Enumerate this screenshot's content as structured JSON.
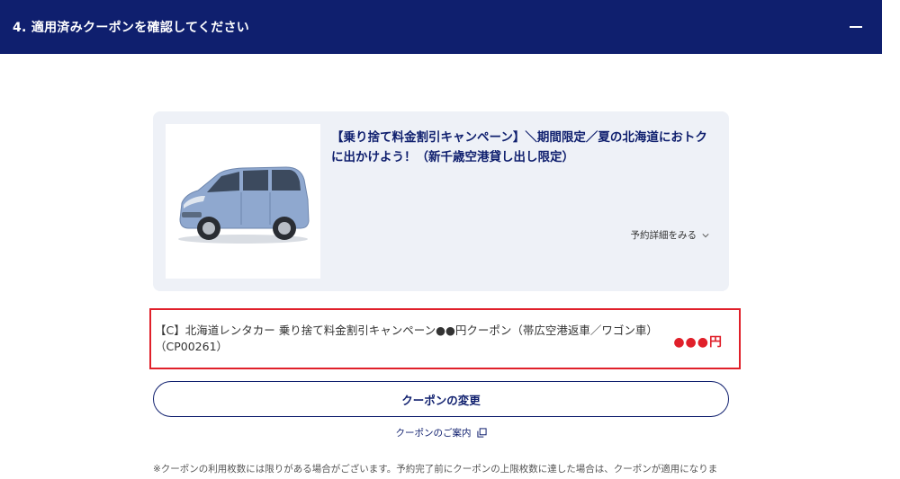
{
  "header": {
    "title": "4. 適用済みクーポンを確認してください"
  },
  "card": {
    "title": "【乗り捨て料金割引キャンペーン】＼期間限定／夏の北海道におトクに出かけよう！（新千歳空港貸し出し限定）",
    "details_label": "予約詳細をみる"
  },
  "coupon": {
    "name": "【C】北海道レンタカー 乗り捨て料金割引キャンペーン●●円クーポン（帯広空港返車／ワゴン車）（CP00261）",
    "amount": "●●●円"
  },
  "actions": {
    "change_label": "クーポンの変更",
    "guide_label": "クーポンのご案内"
  },
  "note": "※クーポンの利用枚数には限りがある場合がございます。予約完了前にクーポンの上限枚数に達した場合は、クーポンが適用になりま",
  "colors": {
    "header_bg": "#0f1f6e",
    "accent_red": "#e0202a",
    "card_bg": "#eef1f7"
  }
}
